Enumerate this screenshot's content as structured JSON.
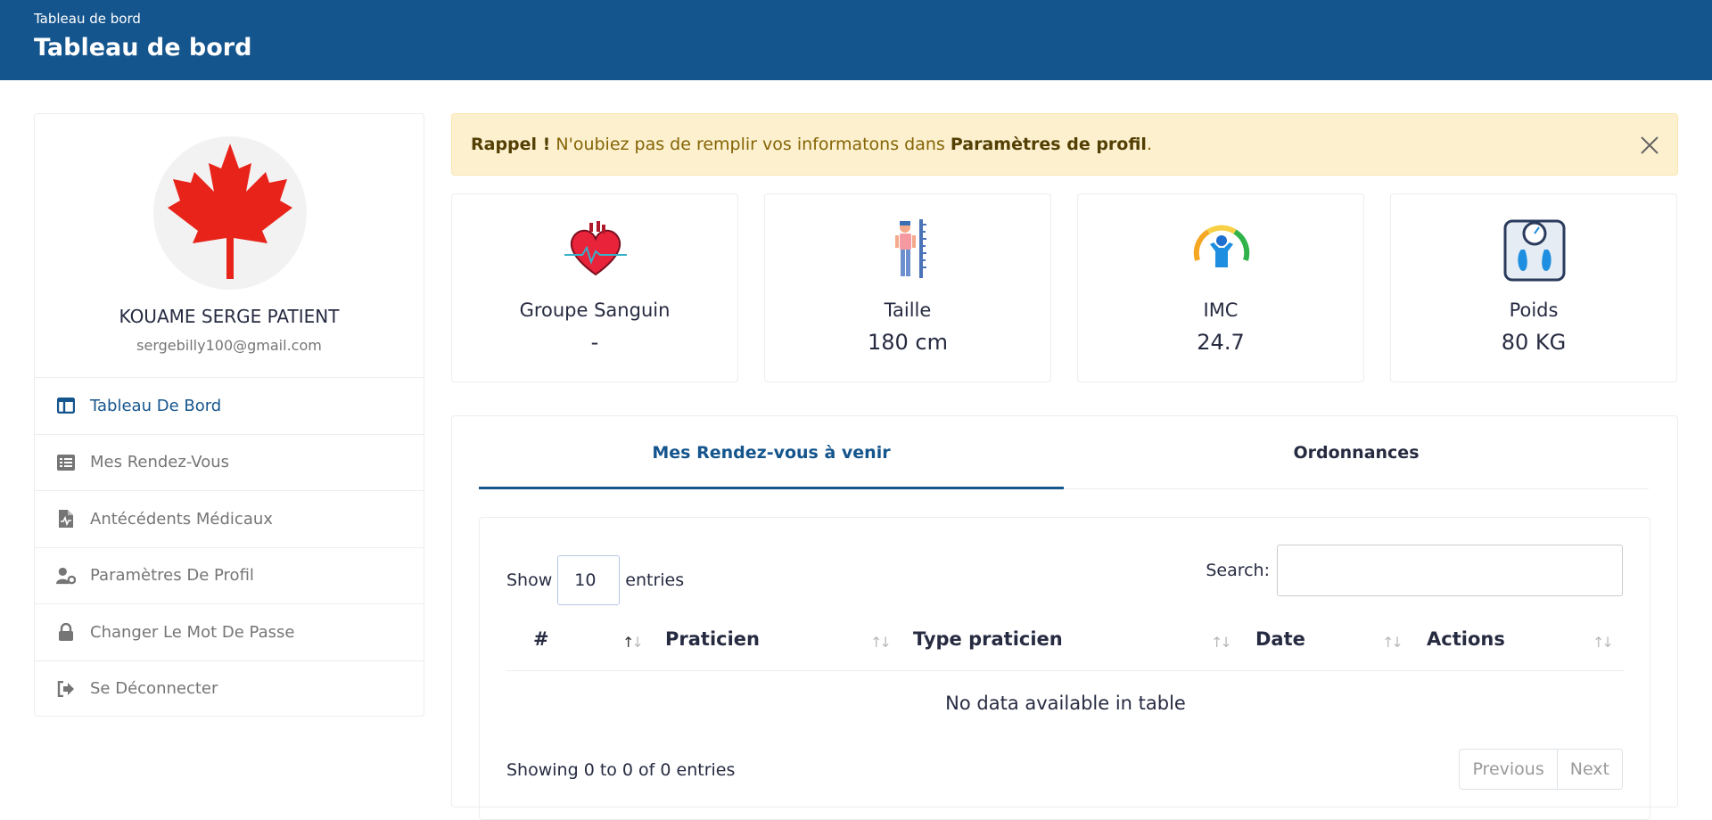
{
  "header": {
    "breadcrumb": "Tableau de bord",
    "title": "Tableau de bord"
  },
  "profile": {
    "name": "KOUAME SERGE PATIENT",
    "email": "sergebilly100@gmail.com"
  },
  "menu": [
    {
      "label": "Tableau De Bord",
      "icon": "columns-icon",
      "active": true
    },
    {
      "label": "Mes Rendez-Vous",
      "icon": "list-icon"
    },
    {
      "label": "Antécédents Médicaux",
      "icon": "medical-file-icon"
    },
    {
      "label": "Paramètres De Profil",
      "icon": "user-cog-icon"
    },
    {
      "label": "Changer Le Mot De Passe",
      "icon": "lock-icon"
    },
    {
      "label": "Se Déconnecter",
      "icon": "sign-out-icon"
    }
  ],
  "alert": {
    "strong": "Rappel !",
    "text": " N'oubiez pas de remplir vos informatons dans ",
    "link": "Paramètres de profil",
    "end": "."
  },
  "stats": [
    {
      "label": "Groupe Sanguin",
      "value": "-",
      "icon": "heart-icon"
    },
    {
      "label": "Taille",
      "value": "180 cm",
      "icon": "height-icon"
    },
    {
      "label": "IMC",
      "value": "24.7",
      "icon": "bmi-gauge-icon"
    },
    {
      "label": "Poids",
      "value": "80 KG",
      "icon": "weighing-scale-icon"
    }
  ],
  "tabs": [
    {
      "label": "Mes Rendez-vous à venir",
      "active": true
    },
    {
      "label": "Ordonnances"
    }
  ],
  "table": {
    "show_label": "Show",
    "page_length": "10",
    "entries_label": "entries",
    "search_label": "Search:",
    "columns": [
      "#",
      "Praticien",
      "Type praticien",
      "Date",
      "Actions"
    ],
    "empty": "No data available in table",
    "info": "Showing 0 to 0 of 0 entries",
    "prev": "Previous",
    "next": "Next"
  },
  "colors": {
    "primary": "#15558d",
    "alert_bg": "#fcf0cf"
  }
}
